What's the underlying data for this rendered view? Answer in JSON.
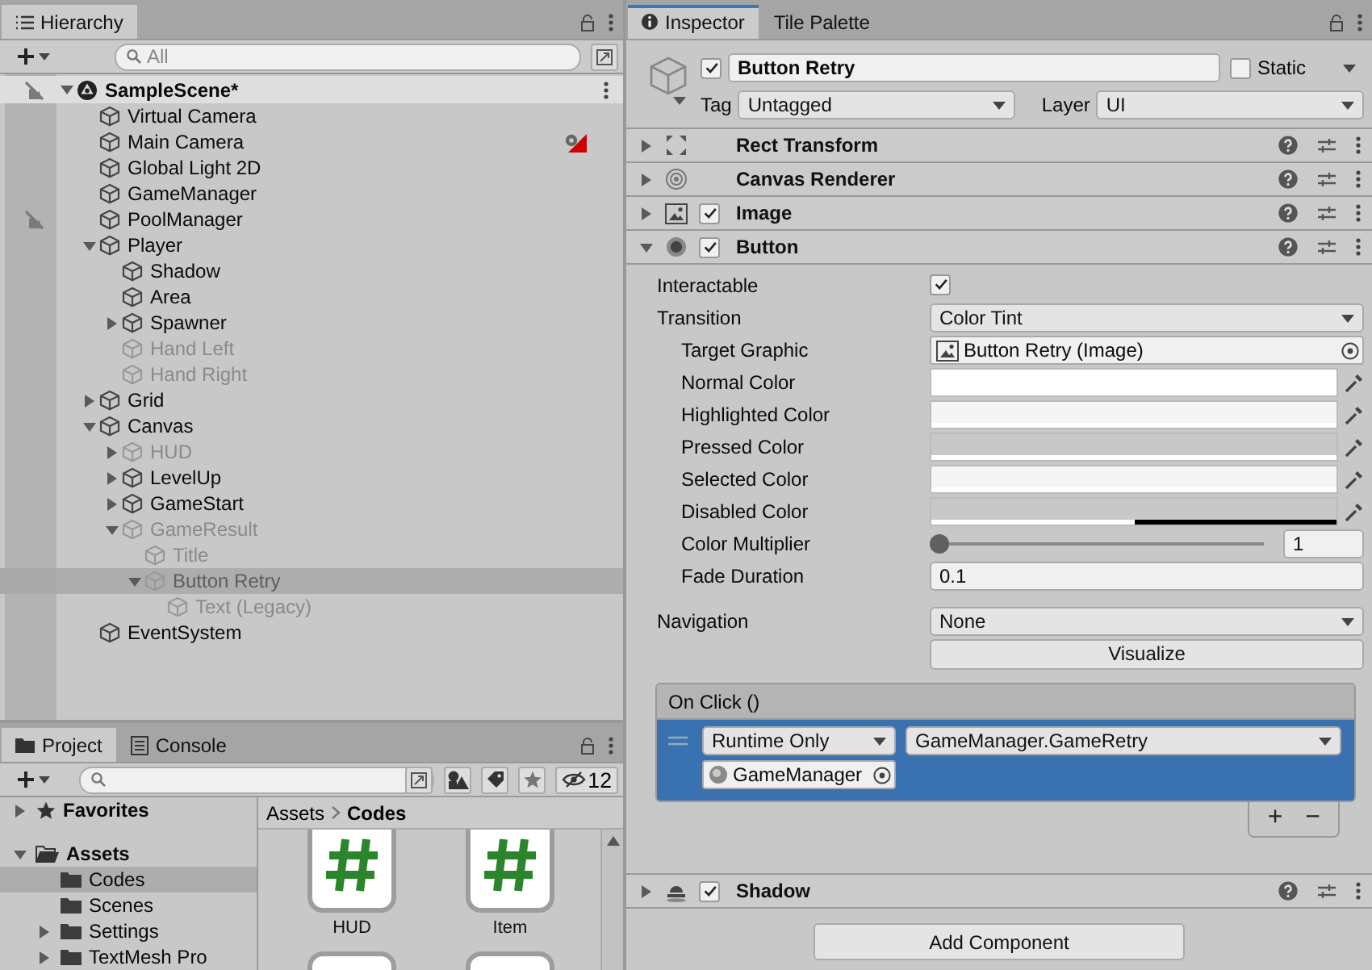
{
  "hierarchy": {
    "tabs": [
      {
        "label": "Hierarchy",
        "selected": true
      }
    ],
    "search": {
      "placeholder": "All"
    },
    "scene": {
      "name": "SampleScene*",
      "expanded": true,
      "unpickable": true
    },
    "items": [
      {
        "name": "Virtual Camera",
        "active": true,
        "selected": false,
        "unpickable": false,
        "gizmo": false
      },
      {
        "name": "Main Camera",
        "active": true,
        "selected": false,
        "unpickable": false,
        "gizmo": true
      },
      {
        "name": "Global Light 2D",
        "active": true,
        "selected": false,
        "unpickable": false,
        "gizmo": false
      },
      {
        "name": "GameManager",
        "active": true,
        "selected": false,
        "unpickable": false,
        "gizmo": false
      },
      {
        "name": "PoolManager",
        "active": true,
        "selected": false,
        "unpickable": true,
        "gizmo": false
      },
      {
        "name": "Player",
        "active": true,
        "selected": false,
        "unpickable": false,
        "gizmo": false,
        "expanded": true,
        "children": [
          {
            "name": "Shadow",
            "active": true,
            "selected": false,
            "unpickable": false,
            "gizmo": false
          },
          {
            "name": "Area",
            "active": true,
            "selected": false,
            "unpickable": false,
            "gizmo": false
          },
          {
            "name": "Spawner",
            "active": true,
            "selected": false,
            "unpickable": false,
            "gizmo": false,
            "expanded": false
          },
          {
            "name": "Hand Left",
            "active": false,
            "selected": false,
            "unpickable": false,
            "gizmo": false
          },
          {
            "name": "Hand Right",
            "active": false,
            "selected": false,
            "unpickable": false,
            "gizmo": false
          }
        ]
      },
      {
        "name": "Grid",
        "active": true,
        "selected": false,
        "unpickable": false,
        "gizmo": false,
        "expanded": false
      },
      {
        "name": "Canvas",
        "active": true,
        "selected": false,
        "unpickable": false,
        "gizmo": false,
        "expanded": true,
        "children": [
          {
            "name": "HUD",
            "active": false,
            "selected": false,
            "unpickable": false,
            "gizmo": false,
            "expanded": false
          },
          {
            "name": "LevelUp",
            "active": true,
            "selected": false,
            "unpickable": false,
            "gizmo": false,
            "expanded": false
          },
          {
            "name": "GameStart",
            "active": true,
            "selected": false,
            "unpickable": false,
            "gizmo": false,
            "expanded": false
          },
          {
            "name": "GameResult",
            "active": false,
            "selected": false,
            "unpickable": false,
            "gizmo": false,
            "expanded": true,
            "children": [
              {
                "name": "Title",
                "active": false,
                "selected": false,
                "unpickable": false,
                "gizmo": false
              },
              {
                "name": "Button Retry",
                "active": false,
                "selected": true,
                "unpickable": false,
                "gizmo": false,
                "expanded": true,
                "children": [
                  {
                    "name": "Text (Legacy)",
                    "active": false,
                    "selected": false,
                    "unpickable": false,
                    "gizmo": false
                  }
                ]
              }
            ]
          }
        ]
      },
      {
        "name": "EventSystem",
        "active": true,
        "selected": false,
        "unpickable": false,
        "gizmo": false
      }
    ]
  },
  "project": {
    "tabs": [
      {
        "label": "Project",
        "selected": true
      },
      {
        "label": "Console",
        "selected": false
      }
    ],
    "hidden_count": "12",
    "folders": [
      {
        "kind": "favorites",
        "name": "Favorites",
        "expanded": false,
        "selected": false
      },
      {
        "kind": "root",
        "name": "Assets",
        "expanded": true,
        "selected": false,
        "children": [
          {
            "kind": "folder",
            "name": "Codes",
            "selected": true
          },
          {
            "kind": "folder",
            "name": "Scenes",
            "selected": false
          },
          {
            "kind": "folder",
            "name": "Settings",
            "selected": false,
            "expanded": false
          },
          {
            "kind": "folder",
            "name": "TextMesh Pro",
            "selected": false,
            "expanded": false
          }
        ]
      }
    ],
    "breadcrumb": [
      "Assets",
      "Codes"
    ],
    "files": [
      {
        "kind": "script",
        "name": "HUD"
      },
      {
        "kind": "script",
        "name": "Item"
      },
      {
        "kind": "script"
      },
      {
        "kind": "script"
      }
    ]
  },
  "inspector": {
    "tabs": [
      {
        "label": "Inspector",
        "selected": true
      },
      {
        "label": "Tile Palette",
        "selected": false
      }
    ],
    "object": {
      "active": true,
      "name": "Button Retry",
      "static": false,
      "static_label": "Static",
      "tag_label": "Tag",
      "tag": "Untagged",
      "layer_label": "Layer",
      "layer": "UI"
    },
    "components": [
      {
        "kind": "transform",
        "name": "Rect Transform",
        "expanded": false
      },
      {
        "kind": "renderer",
        "name": "Canvas Renderer",
        "expanded": false
      },
      {
        "kind": "image",
        "name": "Image",
        "expanded": false,
        "enabled": true
      },
      {
        "kind": "button",
        "name": "Button",
        "expanded": true,
        "enabled": true,
        "properties": [
          {
            "kind": "toggle",
            "label": "Interactable",
            "checked": true
          },
          {
            "kind": "dropdown",
            "label": "Transition",
            "value": "Color Tint",
            "children": [
              {
                "kind": "object",
                "label": "Target Graphic",
                "value": "Button Retry (Image)"
              },
              {
                "kind": "color",
                "label": "Normal Color",
                "color": "#ffffff",
                "level": 1
              },
              {
                "kind": "color",
                "label": "Highlighted Color",
                "color": "#f5f5f5",
                "level": 1
              },
              {
                "kind": "color",
                "label": "Pressed Color",
                "color": "#c8c8c8",
                "level": 1
              },
              {
                "kind": "color",
                "label": "Selected Color",
                "color": "#f5f5f5",
                "level": 1
              },
              {
                "kind": "color",
                "label": "Disabled Color",
                "color": "#c8c8c8",
                "level": 0.5
              },
              {
                "kind": "slider",
                "label": "Color Multiplier",
                "level": 0,
                "value": "1"
              },
              {
                "kind": "number",
                "label": "Fade Duration",
                "value": "0.1"
              }
            ]
          },
          {
            "kind": "dropdown",
            "label": "Navigation",
            "value": "None"
          },
          {
            "kind": "button",
            "label": "Visualize"
          },
          {
            "kind": "event",
            "label": "On Click ()",
            "entries": [
              {
                "mode": "Runtime Only",
                "function": "GameManager.GameRetry",
                "target": "GameManager"
              }
            ],
            "add": "+",
            "remove": "−"
          }
        ]
      },
      {
        "kind": "shadow",
        "name": "Shadow",
        "expanded": false,
        "enabled": true
      }
    ],
    "add_button": "Add Component"
  }
}
